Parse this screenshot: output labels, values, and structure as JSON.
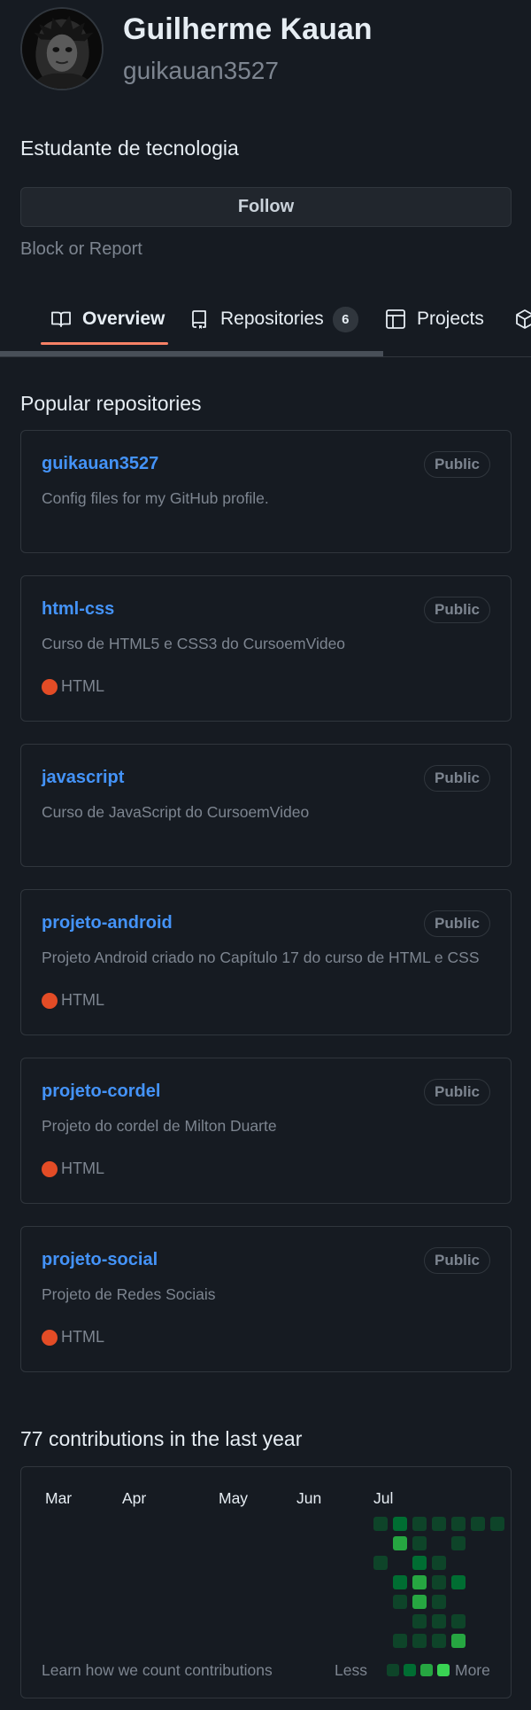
{
  "profile": {
    "full_name": "Guilherme Kauan",
    "username": "guikauan3527",
    "bio": "Estudante de tecnologia",
    "follow_label": "Follow",
    "block_label": "Block or Report"
  },
  "tabs": [
    {
      "label": "Overview",
      "icon": "book-icon"
    },
    {
      "label": "Repositories",
      "icon": "repo-icon",
      "count": "6"
    },
    {
      "label": "Projects",
      "icon": "table-icon"
    },
    {
      "label": "",
      "icon": "package-icon"
    }
  ],
  "popular": {
    "title": "Popular repositories",
    "repos": [
      {
        "name": "guikauan3527",
        "visibility": "Public",
        "description": "Config files for my GitHub profile.",
        "language": ""
      },
      {
        "name": "html-css",
        "visibility": "Public",
        "description": "Curso de HTML5 e CSS3 do CursoemVideo",
        "language": "HTML"
      },
      {
        "name": "javascript",
        "visibility": "Public",
        "description": "Curso de JavaScript do CursoemVideo",
        "language": ""
      },
      {
        "name": "projeto-android",
        "visibility": "Public",
        "description": "Projeto Android criado no Capítulo 17 do curso de HTML e CSS",
        "language": "HTML"
      },
      {
        "name": "projeto-cordel",
        "visibility": "Public",
        "description": "Projeto do cordel de Milton Duarte",
        "language": "HTML"
      },
      {
        "name": "projeto-social",
        "visibility": "Public",
        "description": "Projeto de Redes Sociais",
        "language": "HTML"
      }
    ]
  },
  "contributions": {
    "title": "77 contributions in the last year",
    "months": [
      "Mar",
      "Apr",
      "May",
      "Jun",
      "Jul"
    ],
    "learn_label": "Learn how we count contributions",
    "less_label": "Less",
    "more_label": "More",
    "grid": [
      [
        1,
        2,
        1,
        1,
        1,
        1,
        1
      ],
      [
        0,
        3,
        1,
        0,
        1,
        0,
        0
      ],
      [
        1,
        0,
        2,
        1,
        0,
        0,
        0
      ],
      [
        0,
        2,
        3,
        1,
        2,
        0,
        0
      ],
      [
        0,
        1,
        3,
        1,
        0,
        0,
        0
      ],
      [
        0,
        0,
        1,
        1,
        1,
        0,
        0
      ],
      [
        0,
        1,
        1,
        1,
        3,
        0,
        0
      ]
    ],
    "legend_levels": [
      1,
      2,
      3,
      4
    ]
  },
  "colors": {
    "accent_tab": "#f78166",
    "link": "#4493f8",
    "html_lang": "#e34c26",
    "contrib_levels": [
      "#161b22",
      "#0e4429",
      "#006d32",
      "#26a641",
      "#39d353"
    ]
  }
}
